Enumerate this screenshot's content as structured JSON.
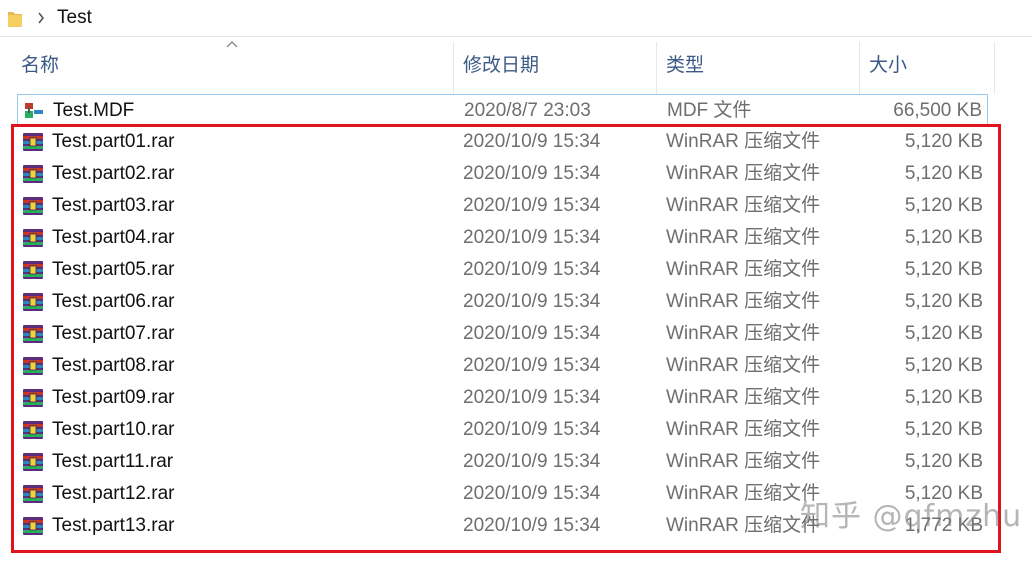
{
  "breadcrumb": {
    "current": "Test"
  },
  "columns": {
    "name": "名称",
    "date": "修改日期",
    "type": "类型",
    "size": "大小"
  },
  "accent": "#3c5a86",
  "highlight_color": "#e0141c",
  "files": [
    {
      "name": "Test.MDF",
      "date": "2020/8/7 23:03",
      "type": "MDF 文件",
      "size": "66,500 KB",
      "icon": "mdf-file-icon"
    },
    {
      "name": "Test.part01.rar",
      "date": "2020/10/9 15:34",
      "type": "WinRAR 压缩文件",
      "size": "5,120 KB",
      "icon": "winrar-archive-icon"
    },
    {
      "name": "Test.part02.rar",
      "date": "2020/10/9 15:34",
      "type": "WinRAR 压缩文件",
      "size": "5,120 KB",
      "icon": "winrar-archive-icon"
    },
    {
      "name": "Test.part03.rar",
      "date": "2020/10/9 15:34",
      "type": "WinRAR 压缩文件",
      "size": "5,120 KB",
      "icon": "winrar-archive-icon"
    },
    {
      "name": "Test.part04.rar",
      "date": "2020/10/9 15:34",
      "type": "WinRAR 压缩文件",
      "size": "5,120 KB",
      "icon": "winrar-archive-icon"
    },
    {
      "name": "Test.part05.rar",
      "date": "2020/10/9 15:34",
      "type": "WinRAR 压缩文件",
      "size": "5,120 KB",
      "icon": "winrar-archive-icon"
    },
    {
      "name": "Test.part06.rar",
      "date": "2020/10/9 15:34",
      "type": "WinRAR 压缩文件",
      "size": "5,120 KB",
      "icon": "winrar-archive-icon"
    },
    {
      "name": "Test.part07.rar",
      "date": "2020/10/9 15:34",
      "type": "WinRAR 压缩文件",
      "size": "5,120 KB",
      "icon": "winrar-archive-icon"
    },
    {
      "name": "Test.part08.rar",
      "date": "2020/10/9 15:34",
      "type": "WinRAR 压缩文件",
      "size": "5,120 KB",
      "icon": "winrar-archive-icon"
    },
    {
      "name": "Test.part09.rar",
      "date": "2020/10/9 15:34",
      "type": "WinRAR 压缩文件",
      "size": "5,120 KB",
      "icon": "winrar-archive-icon"
    },
    {
      "name": "Test.part10.rar",
      "date": "2020/10/9 15:34",
      "type": "WinRAR 压缩文件",
      "size": "5,120 KB",
      "icon": "winrar-archive-icon"
    },
    {
      "name": "Test.part11.rar",
      "date": "2020/10/9 15:34",
      "type": "WinRAR 压缩文件",
      "size": "5,120 KB",
      "icon": "winrar-archive-icon"
    },
    {
      "name": "Test.part12.rar",
      "date": "2020/10/9 15:34",
      "type": "WinRAR 压缩文件",
      "size": "5,120 KB",
      "icon": "winrar-archive-icon"
    },
    {
      "name": "Test.part13.rar",
      "date": "2020/10/9 15:34",
      "type": "WinRAR 压缩文件",
      "size": "1,772 KB",
      "icon": "winrar-archive-icon"
    }
  ],
  "watermark": "知乎 @qfmzhu"
}
